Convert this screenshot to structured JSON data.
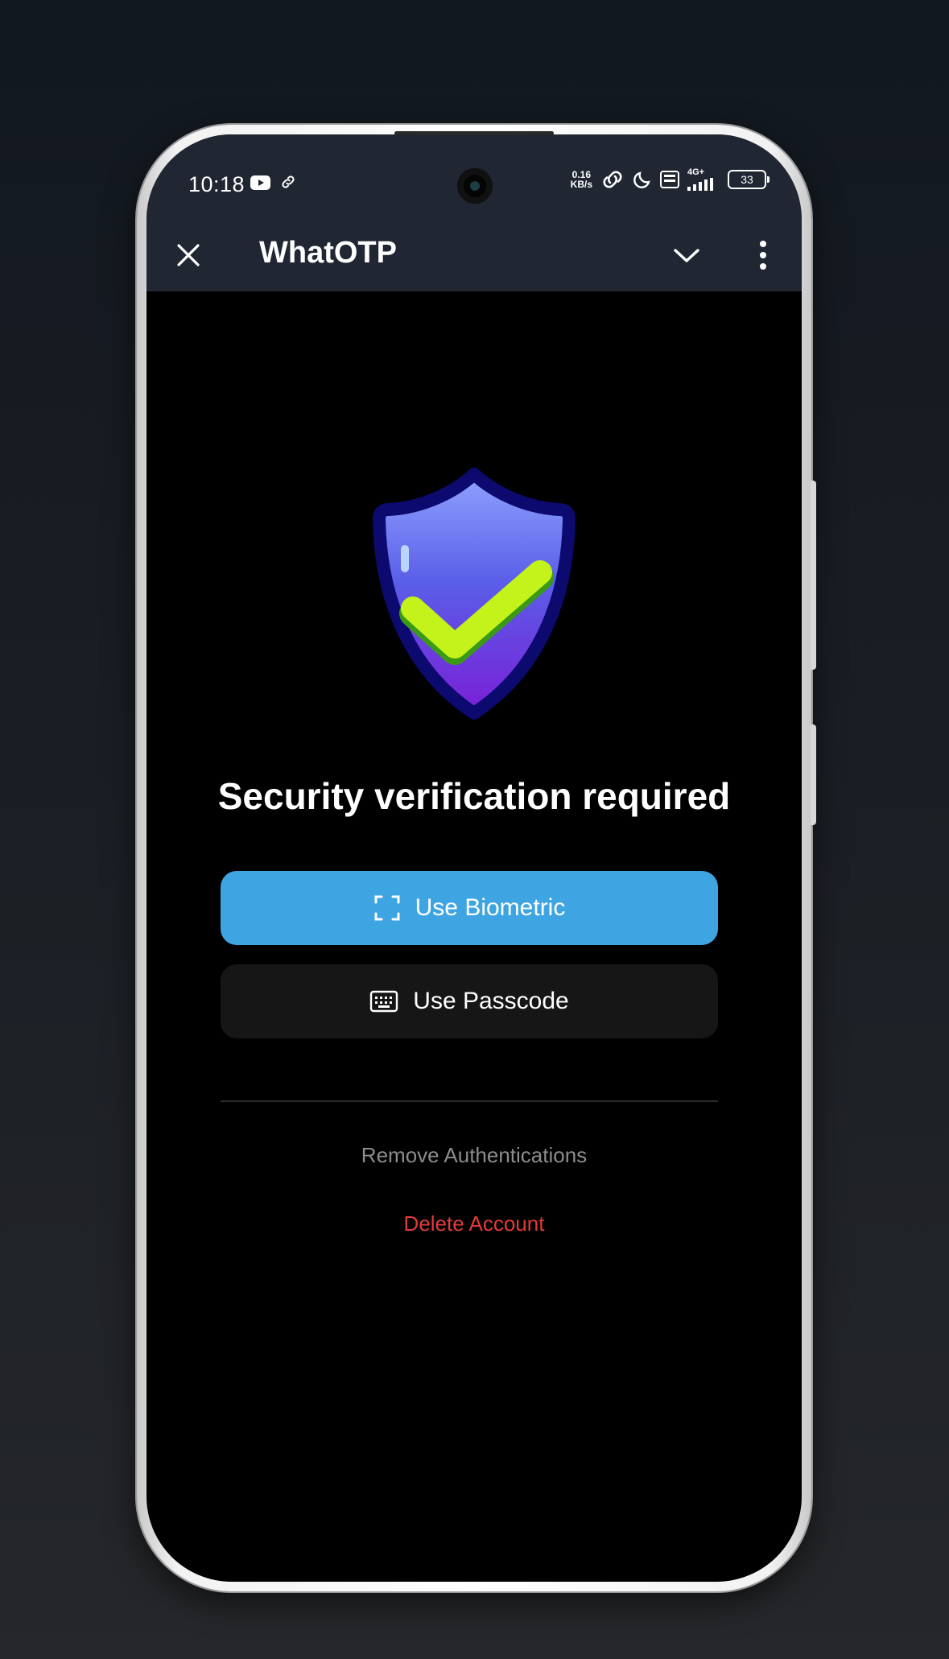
{
  "status_bar": {
    "time": "10:18",
    "net_speed_value": "0.16",
    "net_speed_unit": "KB/s",
    "network_type": "4G+",
    "battery_level": "33"
  },
  "app_bar": {
    "title": "WhatOTP"
  },
  "main": {
    "headline": "Security verification required",
    "biometric_label": "Use Biometric",
    "passcode_label": "Use Passcode",
    "remove_auth_label": "Remove Authentications",
    "delete_account_label": "Delete Account"
  },
  "colors": {
    "primary_button": "#3fa5e2",
    "secondary_button": "#161616",
    "danger_text": "#e33a3a",
    "muted_text": "#8c8c8c",
    "app_bar": "#202733"
  },
  "icons": {
    "close": "close-icon",
    "chevron": "chevron-down-icon",
    "more": "more-vert-icon",
    "biometric": "face-scan-icon",
    "passcode": "keyboard-icon",
    "illustration": "shield-check-icon"
  }
}
